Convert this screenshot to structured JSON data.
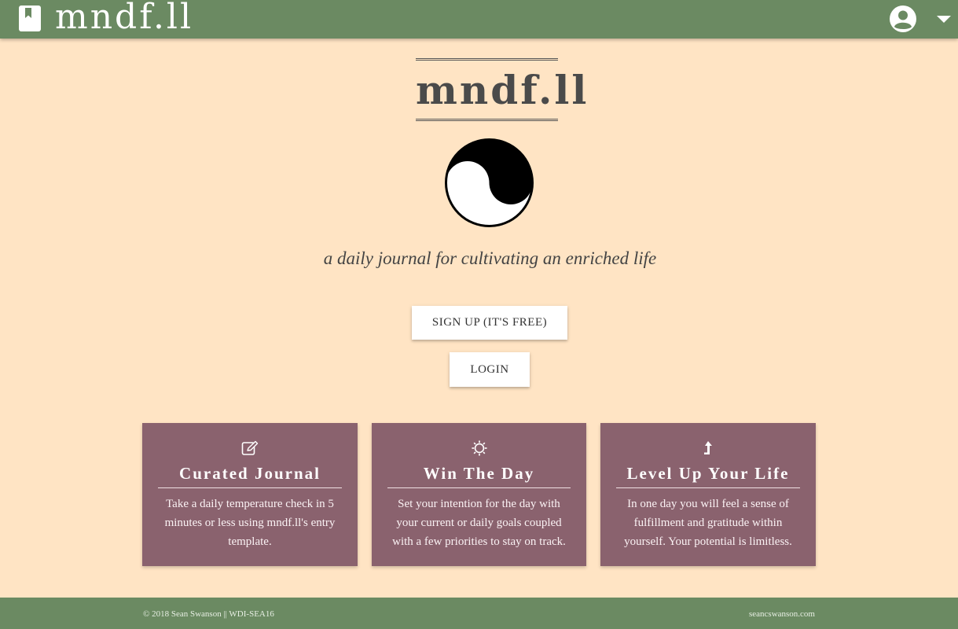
{
  "navbar": {
    "brand": "mndf.ll",
    "brand_icon": "book-icon",
    "account_icon": "account-circle-icon",
    "menu_icon": "caret-down-icon"
  },
  "hero": {
    "title": "mndf.ll",
    "logo": "yin-yang-icon",
    "tagline": "a daily journal for cultivating an enriched life",
    "signup_label": "SIGN UP (IT'S FREE)",
    "login_label": "LOGIN"
  },
  "features": [
    {
      "icon": "edit-icon",
      "title": "Curated Journal",
      "body": "Take a daily temperature check in 5 minutes or less using mndf.ll's entry template."
    },
    {
      "icon": "sun-icon",
      "title": "Win The Day",
      "body": "Set your intention for the day with your current or daily goals coupled with a few priorities to stay on track."
    },
    {
      "icon": "level-up-icon",
      "title": "Level Up Your Life",
      "body": "In one day you will feel a sense of fulfillment and gratitude within yourself. Your potential is limitless."
    }
  ],
  "footer": {
    "copyright": "© 2018 Sean Swanson || WDI-SEA16",
    "site_link": "seancswanson.com"
  },
  "colors": {
    "background": "#ffe4c4",
    "navbar": "#6b8a62",
    "card": "#8a626e",
    "button": "#ffffff"
  }
}
